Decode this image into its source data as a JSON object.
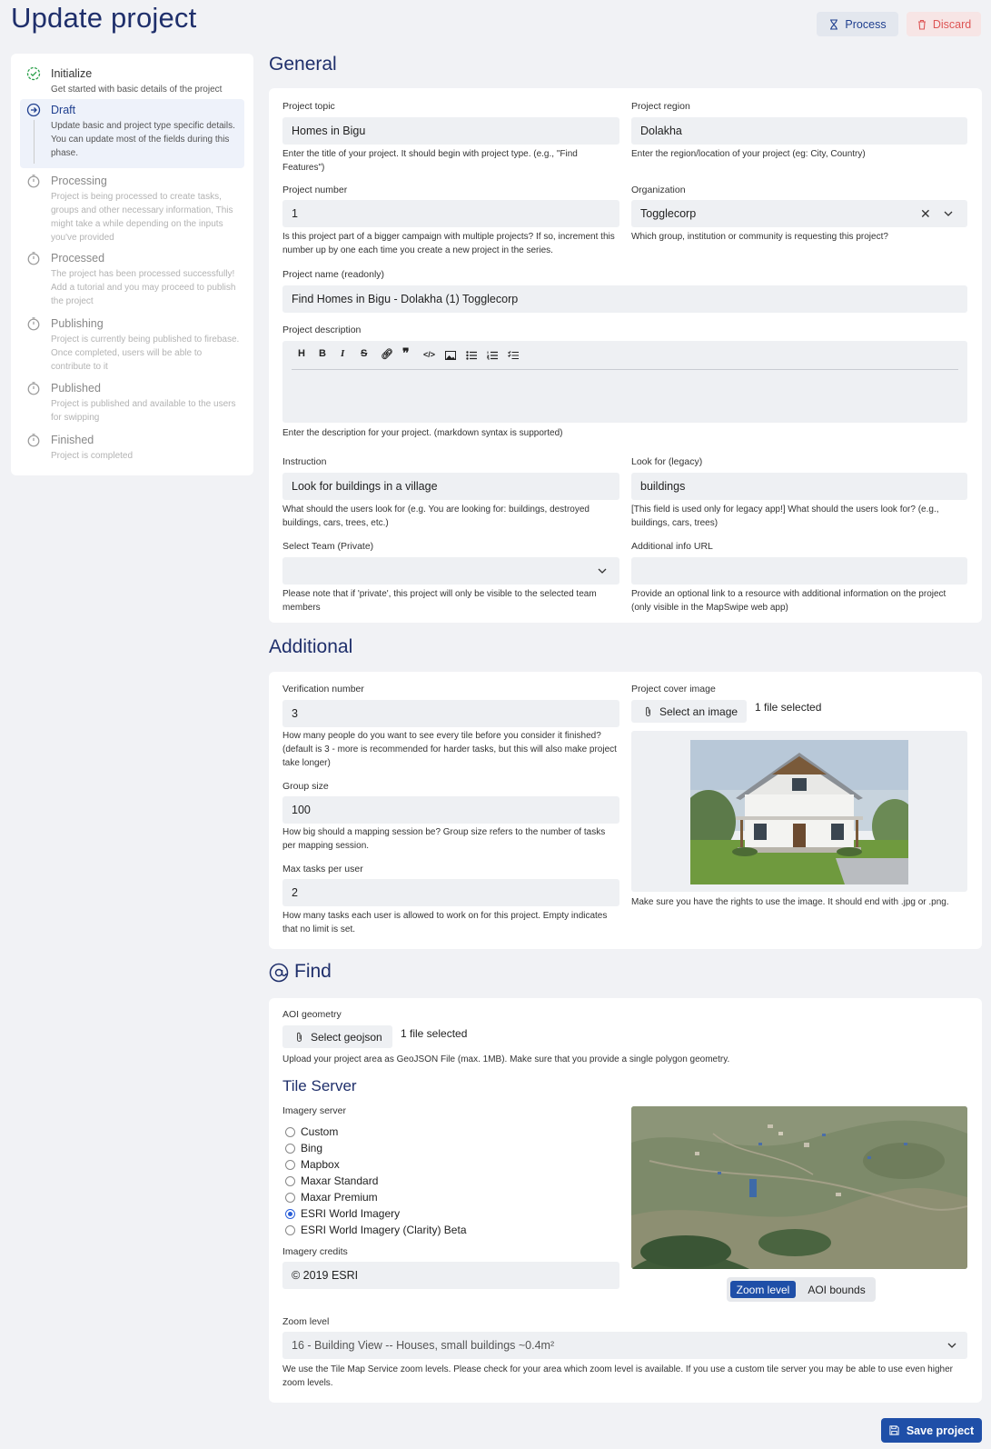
{
  "header": {
    "title": "Update project",
    "process_label": "Process",
    "discard_label": "Discard"
  },
  "steps": [
    {
      "title": "Initialize",
      "desc": "Get started with basic details of the project",
      "state": "done"
    },
    {
      "title": "Draft",
      "desc": "Update basic and project type specific details. You can update most of the fields during this phase.",
      "state": "active"
    },
    {
      "title": "Processing",
      "desc": "Project is being processed to create tasks, groups and other necessary information, This might take a while depending on the inputs you've provided",
      "state": "pending"
    },
    {
      "title": "Processed",
      "desc": "The project has been processed successfully! Add a tutorial and you may proceed to publish the project",
      "state": "pending"
    },
    {
      "title": "Publishing",
      "desc": "Project is currently being published to firebase. Once completed, users will be able to contribute to it",
      "state": "pending"
    },
    {
      "title": "Published",
      "desc": "Project is published and available to the users for swipping",
      "state": "pending"
    },
    {
      "title": "Finished",
      "desc": "Project is completed",
      "state": "pending"
    }
  ],
  "general": {
    "heading": "General",
    "topic": {
      "label": "Project topic",
      "value": "Homes in Bigu",
      "hint": "Enter the title of your project. It should begin with project type. (e.g., \"Find Features\")"
    },
    "region": {
      "label": "Project region",
      "value": "Dolakha",
      "hint": "Enter the region/location of your project (eg: City, Country)"
    },
    "number": {
      "label": "Project number",
      "value": "1",
      "hint": "Is this project part of a bigger campaign with multiple projects? If so, increment this number up by one each time you create a new project in the series."
    },
    "organization": {
      "label": "Organization",
      "value": "Togglecorp",
      "hint": "Which group, institution or community is requesting this project?"
    },
    "name": {
      "label": "Project name (readonly)",
      "value": "Find Homes in Bigu - Dolakha (1) Togglecorp"
    },
    "description": {
      "label": "Project description",
      "hint": "Enter the description for your project. (markdown syntax is supported)"
    },
    "instruction": {
      "label": "Instruction",
      "value": "Look for buildings in a village",
      "hint": "What should the users look for (e.g. You are looking for: buildings, destroyed buildings, cars, trees, etc.)"
    },
    "lookfor": {
      "label": "Look for (legacy)",
      "value": "buildings",
      "hint": "[This field is used only for legacy app!] What should the users look for? (e.g., buildings, cars, trees)"
    },
    "team": {
      "label": "Select Team (Private)",
      "value": "",
      "hint": "Please note that if 'private', this project will only be visible to the selected team members"
    },
    "info_url": {
      "label": "Additional info URL",
      "value": "",
      "hint": "Provide an optional link to a resource with additional information on the project (only visible in the MapSwipe web app)"
    }
  },
  "additional": {
    "heading": "Additional",
    "verification": {
      "label": "Verification number",
      "value": "3",
      "hint": "How many people do you want to see every tile before you consider it finished? (default is 3 - more is recommended for harder tasks, but this will also make project take longer)"
    },
    "group_size": {
      "label": "Group size",
      "value": "100",
      "hint": "How big should a mapping session be? Group size refers to the number of tasks per mapping session."
    },
    "max_tasks": {
      "label": "Max tasks per user",
      "value": "2",
      "hint": "How many tasks each user is allowed to work on for this project. Empty indicates that no limit is set."
    },
    "cover": {
      "label": "Project cover image",
      "button": "Select an image",
      "status": "1 file selected",
      "hint": "Make sure you have the rights to use the image. It should end with .jpg or .png."
    }
  },
  "find": {
    "heading": "Find",
    "aoi": {
      "label": "AOI geometry",
      "button": "Select geojson",
      "status": "1 file selected",
      "hint": "Upload your project area as GeoJSON File (max. 1MB). Make sure that you provide a single polygon geometry."
    },
    "tile_server_heading": "Tile Server",
    "imagery_label": "Imagery server",
    "imagery_options": [
      "Custom",
      "Bing",
      "Mapbox",
      "Maxar Standard",
      "Maxar Premium",
      "ESRI World Imagery",
      "ESRI World Imagery (Clarity) Beta"
    ],
    "imagery_selected": "ESRI World Imagery",
    "credits": {
      "label": "Imagery credits",
      "value": "© 2019 ESRI"
    },
    "map_tabs": {
      "active": "Zoom level",
      "other": "AOI bounds"
    },
    "zoom": {
      "label": "Zoom level",
      "value": "16 - Building View -- Houses, small buildings ~0.4m²",
      "hint": "We use the Tile Map Service zoom levels. Please check for your area which zoom level is available. If you use a custom tile server you may be able to use even higher zoom levels."
    }
  },
  "save_label": "Save project"
}
